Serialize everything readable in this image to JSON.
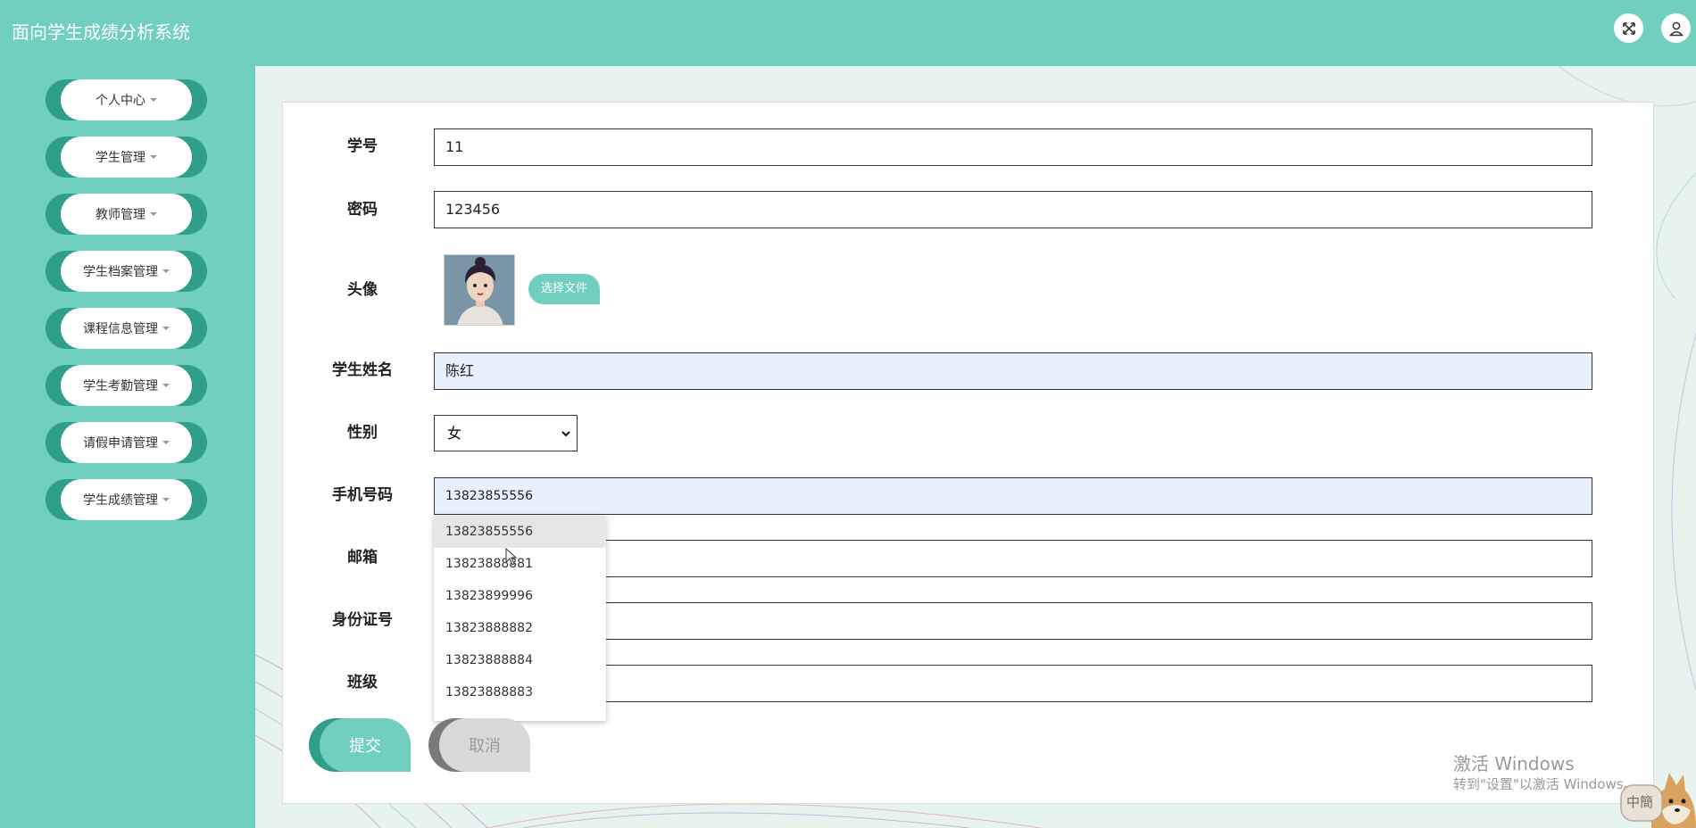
{
  "app": {
    "title": "面向学生成绩分析系统"
  },
  "header": {
    "fullscreen_icon": "expand-icon",
    "user_icon": "user-icon"
  },
  "sidebar": {
    "items": [
      {
        "label": "个人中心"
      },
      {
        "label": "学生管理"
      },
      {
        "label": "教师管理"
      },
      {
        "label": "学生档案管理"
      },
      {
        "label": "课程信息管理"
      },
      {
        "label": "学生考勤管理"
      },
      {
        "label": "请假申请管理"
      },
      {
        "label": "学生成绩管理"
      }
    ]
  },
  "form": {
    "student_id": {
      "label": "学号",
      "value": "11"
    },
    "password": {
      "label": "密码",
      "value": "123456"
    },
    "avatar": {
      "label": "头像",
      "button": "选择文件"
    },
    "name": {
      "label": "学生姓名",
      "value": "陈红"
    },
    "gender": {
      "label": "性别",
      "value": "女"
    },
    "phone": {
      "label": "手机号码",
      "value": "13823855556"
    },
    "email": {
      "label": "邮箱",
      "value": ""
    },
    "id_number": {
      "label": "身份证号",
      "value": ""
    },
    "class": {
      "label": "班级",
      "value": ""
    },
    "submit": "提交",
    "cancel": "取消"
  },
  "autocomplete": [
    "13823855556",
    "13823888881",
    "13823899996",
    "13823888882",
    "13823888884",
    "13823888883"
  ],
  "watermark": {
    "line1": "激活 Windows",
    "line2": "转到\"设置\"以激活 Windows。"
  },
  "ime": {
    "label": "中簡"
  },
  "colors": {
    "primary": "#70cfbf",
    "dark": "#2f9e8a",
    "autofill": "#e8f0fe"
  }
}
